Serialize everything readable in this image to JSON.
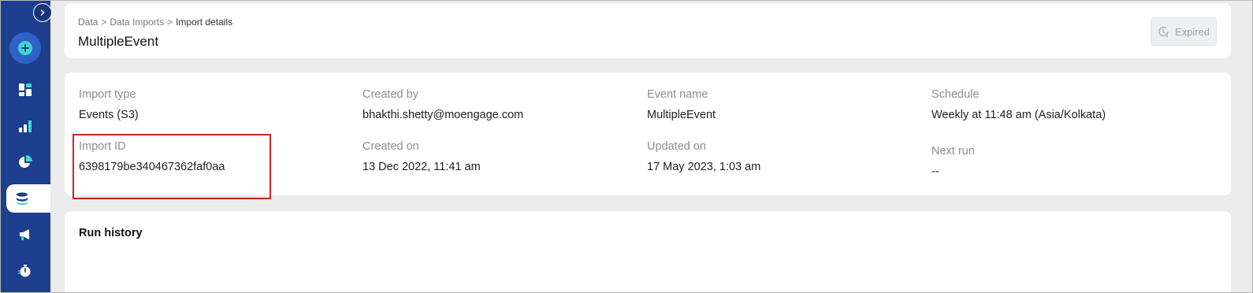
{
  "sidebar": {
    "items": [
      {
        "icon": "dashboard-icon"
      },
      {
        "icon": "bar-chart-icon"
      },
      {
        "icon": "pie-chart-icon"
      },
      {
        "icon": "database-icon",
        "active": true
      },
      {
        "icon": "megaphone-icon"
      },
      {
        "icon": "stopwatch-icon"
      }
    ]
  },
  "header": {
    "breadcrumb": [
      "Data",
      "Data Imports",
      "Import details"
    ],
    "separator": ">",
    "title": "MultipleEvent",
    "status_label": "Expired"
  },
  "details": {
    "import_type": {
      "label": "Import type",
      "value": "Events (S3)"
    },
    "created_by": {
      "label": "Created by",
      "value": "bhakthi.shetty@moengage.com"
    },
    "event_name": {
      "label": "Event name",
      "value": "MultipleEvent"
    },
    "schedule": {
      "label": "Schedule",
      "value": "Weekly at 11:48 am (Asia/Kolkata)"
    },
    "import_id": {
      "label": "Import ID",
      "value": "6398179be340467362faf0aa"
    },
    "created_on": {
      "label": "Created on",
      "value": "13 Dec 2022, 11:41 am"
    },
    "updated_on": {
      "label": "Updated on",
      "value": "17 May 2023, 1:03 am"
    },
    "next_run": {
      "label": "Next run",
      "value": "--"
    }
  },
  "run_history": {
    "title": "Run history"
  },
  "colors": {
    "sidebar_bg": "#1d3f8e",
    "accent": "#3fd7d2",
    "highlight": "#c62828"
  }
}
